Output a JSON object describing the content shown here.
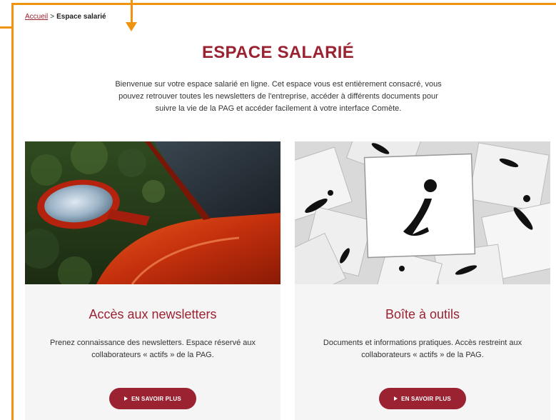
{
  "breadcrumb": {
    "home_label": "Accueil",
    "separator": ">",
    "current_label": "Espace salarié"
  },
  "page": {
    "title": "ESPACE SALARIÉ",
    "intro": "Bienvenue sur votre espace salarié en ligne. Cet espace vous est entièrement consacré, vous pouvez retrouver toutes les newsletters de l'entreprise, accéder à différents documents pour suivre la vie de la PAG et accéder facilement à votre interface Comète."
  },
  "cards": [
    {
      "title": "Accès aux newsletters",
      "description": "Prenez connaissance des newsletters. Espace réservé aux collaborateurs « actifs » de la PAG.",
      "button_label": "EN SAVOIR PLUS",
      "image_icon": "car-mirror-photo"
    },
    {
      "title": "Boîte à outils",
      "description": "Documents et informations pratiques. Accès restreint aux collaborateurs « actifs » de la PAG.",
      "button_label": "EN SAVOIR PLUS",
      "image_icon": "info-cards-photo"
    }
  ],
  "colors": {
    "brand": "#9b2231",
    "frame": "#f0930e",
    "card_bg": "#f5f5f5"
  }
}
